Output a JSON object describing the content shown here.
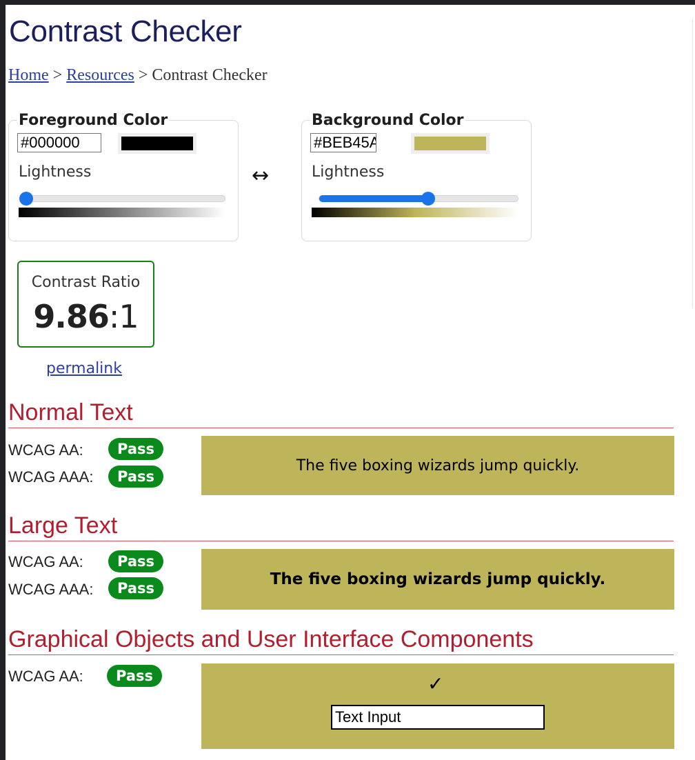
{
  "page": {
    "title": "Contrast Checker"
  },
  "breadcrumb": {
    "items": [
      "Home",
      "Resources",
      "Contrast Checker"
    ],
    "separator": ">"
  },
  "foreground": {
    "legend": "Foreground Color",
    "hex": "#000000",
    "swatch_color": "#000000",
    "lightness_label": "Lightness",
    "lightness_percent": 0
  },
  "background": {
    "legend": "Background Color",
    "hex": "#BEB45A",
    "swatch_color": "#BEB45A",
    "lightness_label": "Lightness",
    "lightness_percent": 55
  },
  "swap": {
    "glyph": "↔"
  },
  "contrast": {
    "label": "Contrast Ratio",
    "ratio_bold": "9.86",
    "ratio_suffix": ":1",
    "border_color": "#1a7f1a"
  },
  "permalink": {
    "label": "permalink"
  },
  "normal_text": {
    "heading": "Normal Text",
    "aa_label": "WCAG AA:",
    "aa_result": "Pass",
    "aaa_label": "WCAG AAA:",
    "aaa_result": "Pass",
    "sample": "The five boxing wizards jump quickly."
  },
  "large_text": {
    "heading": "Large Text",
    "aa_label": "WCAG AA:",
    "aa_result": "Pass",
    "aaa_label": "WCAG AAA:",
    "aaa_result": "Pass",
    "sample": "The five boxing wizards jump quickly."
  },
  "graphical": {
    "heading": "Graphical Objects and User Interface Components",
    "aa_label": "WCAG AA:",
    "aa_result": "Pass",
    "checkmark": "✓",
    "input_value": "Text Input"
  },
  "colors": {
    "heading_red": "#b01e2f",
    "pass_green": "#0b8a1c",
    "link_blue": "#2c3fa3",
    "slider_blue": "#1a73e8"
  }
}
